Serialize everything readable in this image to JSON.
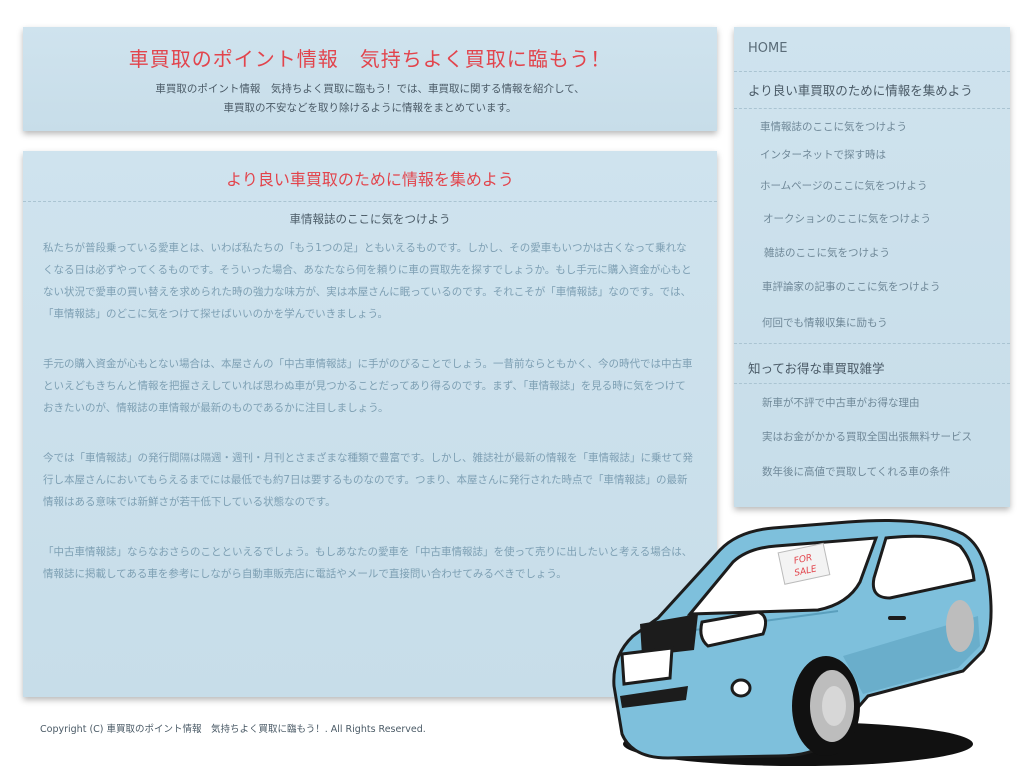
{
  "header": {
    "title": "車買取のポイント情報　気持ちよく買取に臨もう！",
    "description_line1": "車買取のポイント情報　気持ちよく買取に臨もう！では、車買取に関する情報を紹介して、",
    "description_line2": "車買取の不安などを取り除けるように情報をまとめています。"
  },
  "main": {
    "heading": "より良い車買取のために情報を集めよう",
    "subheading": "車情報誌のここに気をつけよう",
    "paragraphs": [
      "私たちが普段乗っている愛車とは、いわば私たちの「もう1つの足」ともいえるものです。しかし、その愛車もいつかは古くなって乗れなくなる日は必ずやってくるものです。そういった場合、あなたなら何を頼りに車の買取先を探すでしょうか。もし手元に購入資金が心もとない状況で愛車の買い替えを求められた時の強力な味方が、実は本屋さんに眠っているのです。それこそが「車情報誌」なのです。では、「車情報誌」のどこに気をつけて探せばいいのかを学んでいきましょう。",
      "手元の購入資金が心もとない場合は、本屋さんの「中古車情報誌」に手がのびることでしょう。一昔前ならともかく、今の時代では中古車といえどもきちんと情報を把握さえしていれば思わぬ車が見つかることだってあり得るのです。まず、「車情報誌」を見る時に気をつけておきたいのが、情報誌の車情報が最新のものであるかに注目しましょう。",
      "今では「車情報誌」の発行間隔は隔週・週刊・月刊とさまざまな種類で豊富です。しかし、雑誌社が最新の情報を「車情報誌」に乗せて発行し本屋さんにおいてもらえるまでには最低でも約7日は要するものなのです。つまり、本屋さんに発行された時点で「車情報誌」の最新情報はある意味では新鮮さが若干低下している状態なのです。",
      "「中古車情報誌」ならなおさらのことといえるでしょう。もしあなたの愛車を「中古車情報誌」を使って売りに出したいと考える場合は、情報誌に掲載してある車を参考にしながら自動車販売店に電話やメールで直接問い合わせてみるべきでしょう。"
    ]
  },
  "sidebar": {
    "home": "HOME",
    "section1": {
      "heading": "より良い車買取のために情報を集めよう",
      "items": [
        "車情報誌のここに気をつけよう",
        "インターネットで探す時は",
        "ホームページのここに気をつけよう",
        "オークションのここに気をつけよう",
        "雑誌のここに気をつけよう",
        "車評論家の記事のここに気をつけよう",
        "何回でも情報収集に励もう"
      ]
    },
    "section2": {
      "heading": "知ってお得な車買取雑学",
      "items": [
        "新車が不評で中古車がお得な理由",
        "実はお金がかかる買取全国出張無料サービス",
        "数年後に高値で買取してくれる車の条件"
      ]
    }
  },
  "car_sign": {
    "line1": "FOR",
    "line2": "SALE"
  },
  "footer": {
    "copyright": "Copyright (C)  車買取のポイント情報　気持ちよく買取に臨もう！.  All Rights Reserved."
  },
  "colors": {
    "accent_red": "#e2444c",
    "panel_blue": "#cfe3ee",
    "car_body": "#7ec0dc"
  },
  "icons": {
    "car_illustration": "blue-car-for-sale"
  }
}
